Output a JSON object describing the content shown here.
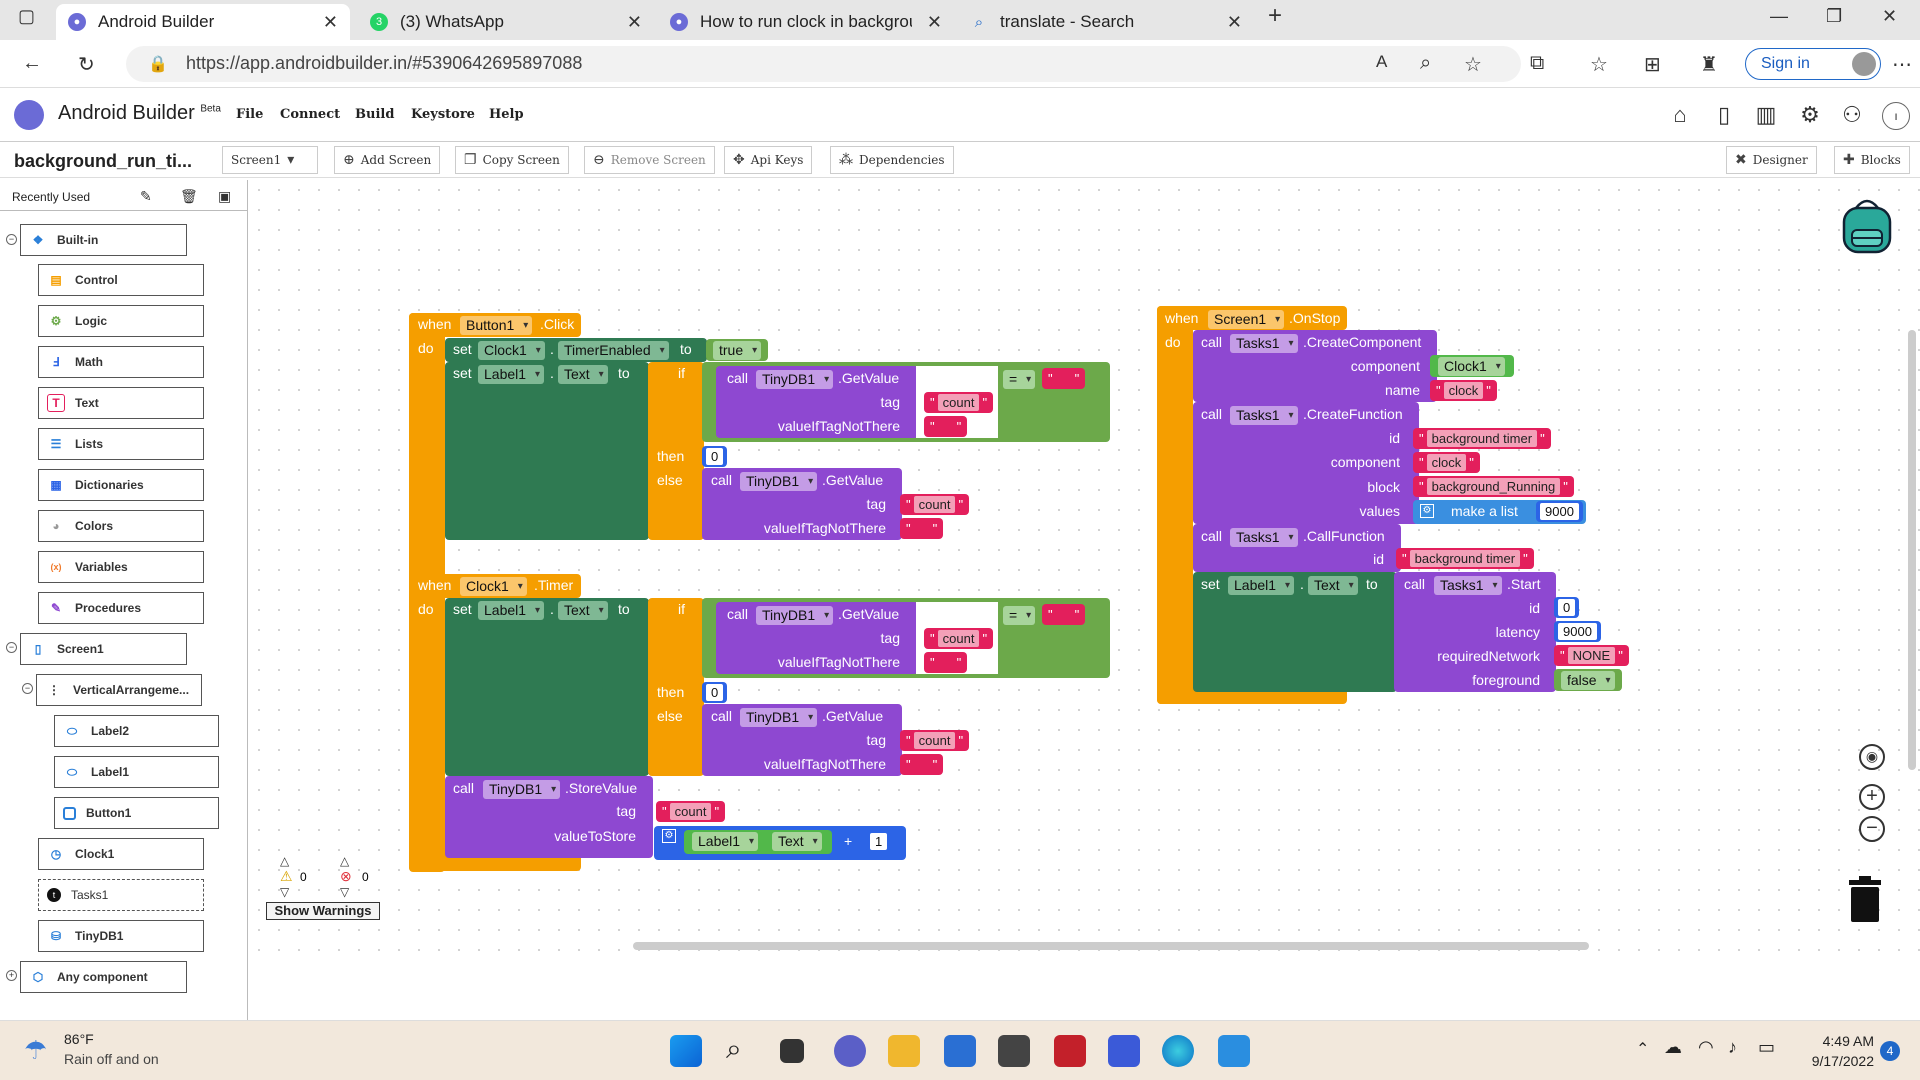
{
  "browser": {
    "tabs": [
      {
        "title": "Android Builder",
        "active": true,
        "icon": "android-builder-icon"
      },
      {
        "title": "(3) WhatsApp",
        "active": false,
        "icon": "whatsapp-icon"
      },
      {
        "title": "How to run clock in background",
        "active": false,
        "icon": "android-builder-icon"
      },
      {
        "title": "translate - Search",
        "active": false,
        "icon": "search-icon"
      }
    ],
    "url": "https://app.androidbuilder.in/#5390642695897088",
    "sign_in": "Sign in"
  },
  "app": {
    "title": "Android Builder",
    "badge": "Beta",
    "menu": [
      "File",
      "Connect",
      "Build",
      "Keystore",
      "Help"
    ]
  },
  "toolbar": {
    "project_name": "background_run_ti...",
    "screen_select": "Screen1",
    "add_screen": "Add Screen",
    "copy_screen": "Copy Screen",
    "remove_screen": "Remove Screen",
    "api_keys": "Api Keys",
    "dependencies": "Dependencies",
    "designer": "Designer",
    "blocks": "Blocks"
  },
  "sidebar": {
    "recently_used": "Recently Used",
    "builtin": "Built-in",
    "builtin_items": [
      "Control",
      "Logic",
      "Math",
      "Text",
      "Lists",
      "Dictionaries",
      "Colors",
      "Variables",
      "Procedures"
    ],
    "screen": "Screen1",
    "arrangement": "VerticalArrangeme...",
    "arrangement_children": [
      "Label2",
      "Label1",
      "Button1"
    ],
    "components": [
      "Clock1",
      "Tasks1",
      "TinyDB1"
    ],
    "any_component": "Any component"
  },
  "blocks": {
    "when": "when",
    "do": "do",
    "set": "set",
    "to": "to",
    "call": "call",
    "if": "if",
    "then": "then",
    "else": "else",
    "true": "true",
    "false": "false",
    "button1": "Button1",
    "click": ".Click",
    "clock1": "Clock1",
    "timer": ".Timer",
    "timer_enabled": "TimerEnabled",
    "label1": "Label1",
    "text": "Text",
    "tinydb1": "TinyDB1",
    "getvalue": ".GetValue",
    "storevalue": ".StoreValue",
    "tag": "tag",
    "value_if": "valueIfTagNotThere",
    "value_to_store": "valueToStore",
    "count": "count",
    "zero": "0",
    "one": "1",
    "eq": "=",
    "plus": "+",
    "screen1": "Screen1",
    "onstop": ".OnStop",
    "tasks1": "Tasks1",
    "create_component": ".CreateComponent",
    "component": "component",
    "name": "name",
    "clock": "clock",
    "create_function": ".CreateFunction",
    "id": "id",
    "block": "block",
    "values": "values",
    "background_timer": "background timer",
    "background_running": "background_Running",
    "make_a_list": "make a list",
    "nine_thousand": "9000",
    "call_function": ".CallFunction",
    "start": ".Start",
    "latency": "latency",
    "required_network": "requiredNetwork",
    "none": "NONE",
    "foreground": "foreground"
  },
  "warnings": {
    "warning_count": "0",
    "error_count": "0",
    "show_warnings": "Show Warnings"
  },
  "taskbar": {
    "temperature": "86°F",
    "weather": "Rain off and on",
    "time": "4:49 AM",
    "date": "9/17/2022",
    "notifications": "4"
  },
  "colors": {
    "event": "#f59e00",
    "setter": "#2f7a52",
    "logic": "#6ca94a",
    "component_method": "#8e48d1",
    "text": "#e31f5c",
    "math": "#2c64e6"
  }
}
